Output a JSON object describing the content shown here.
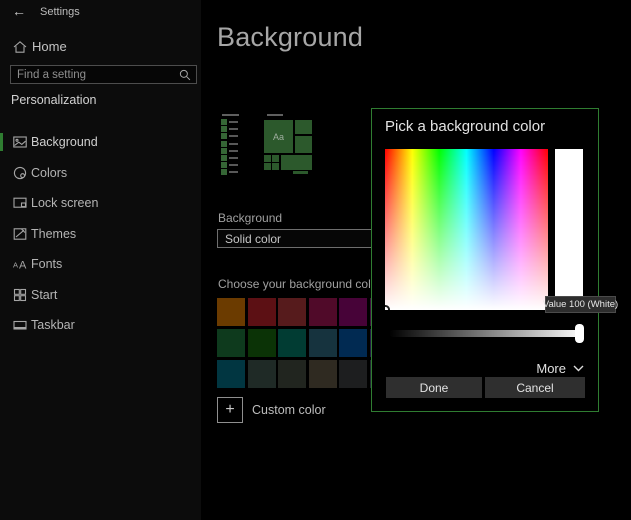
{
  "titlebar": {
    "back_glyph": "←",
    "title": "Settings"
  },
  "sidebar": {
    "home_label": "Home",
    "search_placeholder": "Find a setting",
    "section_header": "Personalization",
    "items": [
      {
        "label": "Background",
        "selected": true
      },
      {
        "label": "Colors",
        "selected": false
      },
      {
        "label": "Lock screen",
        "selected": false
      },
      {
        "label": "Themes",
        "selected": false
      },
      {
        "label": "Fonts",
        "selected": false
      },
      {
        "label": "Start",
        "selected": false
      },
      {
        "label": "Taskbar",
        "selected": false
      }
    ]
  },
  "main": {
    "title": "Background",
    "preview_tile_label": "Aa",
    "background_section_label": "Background",
    "background_dropdown_value": "Solid color",
    "choose_color_label": "Choose your background color",
    "swatch_rows": [
      [
        "#6b3b00",
        "#5c1014",
        "#561b1c",
        "#500a29",
        "#470338",
        "#3f1040"
      ],
      [
        "#0e3a1d",
        "#0b3306",
        "#013c33",
        "#16333e",
        "#012a52",
        "#241a44"
      ],
      [
        "#013641",
        "#1f2a26",
        "#21251f",
        "#2f2a21",
        "#1d1e1f",
        "#232733"
      ]
    ],
    "custom_color_label": "Custom color",
    "plus_glyph": "+"
  },
  "dialog": {
    "title": "Pick a background color",
    "tooltip": "Value 100 (White)",
    "more_label": "More",
    "done_label": "Done",
    "cancel_label": "Cancel"
  },
  "colors": {
    "accent_green_border": "#2f7d31",
    "sidebar_bg": "#0c0c0c",
    "content_bg": "#000000",
    "button_bg": "#2f2f2f",
    "tooltip_bg": "#2d2d2d",
    "preview_tile_green": "#2c592c"
  }
}
